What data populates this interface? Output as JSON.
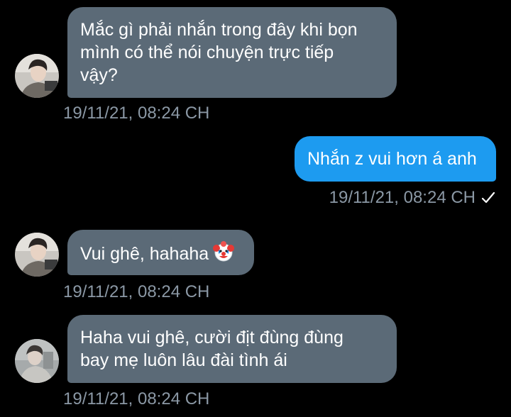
{
  "colors": {
    "background": "#000000",
    "incoming_bubble": "#5b6a77",
    "outgoing_bubble": "#1d9bf0",
    "timestamp": "#8b98a5"
  },
  "messages": [
    {
      "direction": "incoming",
      "lines": [
        "Mắc gì phải nhắn trong đây khi bọn",
        "mình có thể nói chuyện trực tiếp",
        "vậy?"
      ],
      "timestamp": "19/11/21, 08:24 CH"
    },
    {
      "direction": "outgoing",
      "text": "Nhắn z vui hơn á anh",
      "timestamp": "19/11/21, 08:24 CH",
      "read_icon": "checkmark-icon"
    },
    {
      "direction": "incoming",
      "text": "Vui ghê, hahaha",
      "emoji": "clown-face-icon",
      "timestamp": "19/11/21, 08:24 CH"
    },
    {
      "direction": "incoming",
      "lines": [
        "Haha vui ghê, cười địt đùng đùng",
        "bay mẹ luôn lâu đài tình ái"
      ],
      "timestamp": "19/11/21, 08:24 CH"
    }
  ]
}
